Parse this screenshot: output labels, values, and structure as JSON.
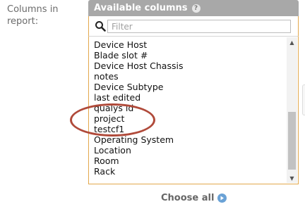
{
  "form": {
    "label_line1": "Columns in",
    "label_line2": "report:"
  },
  "panel": {
    "title": "Available columns",
    "help_icon": "help-icon",
    "filter": {
      "icon": "search-icon",
      "placeholder": "Filter",
      "value": ""
    },
    "items": [
      {
        "label": "Device Host"
      },
      {
        "label": "Blade slot #"
      },
      {
        "label": "Device Host Chassis"
      },
      {
        "label": "notes"
      },
      {
        "label": "Device Subtype"
      },
      {
        "label": "last edited"
      },
      {
        "label": "qualys id"
      },
      {
        "label": "project"
      },
      {
        "label": "testcf1"
      },
      {
        "label": "Operating System"
      },
      {
        "label": "Location"
      },
      {
        "label": "Room"
      },
      {
        "label": "Rack"
      }
    ],
    "scroll_position": 0.55
  },
  "actions": {
    "choose_all_label": "Choose all",
    "choose_all_icon": "arrow-right-circle-icon"
  },
  "colors": {
    "accent_border": "#e3a84c",
    "header_bg": "#a8a8a8",
    "highlight_ring": "#b04a3a",
    "action_icon": "#6aa2d6"
  }
}
